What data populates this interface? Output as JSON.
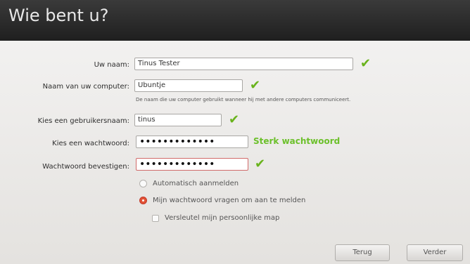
{
  "window": {
    "title": "Wie bent u?"
  },
  "form": {
    "name": {
      "label": "Uw naam:",
      "value": "Tinus Tester"
    },
    "computer": {
      "label": "Naam van uw computer:",
      "value": "Ubuntje",
      "hint": "De naam die uw computer gebruikt wanneer hij met andere computers communiceert."
    },
    "username": {
      "label": "Kies een gebruikersnaam:",
      "value": "tinus"
    },
    "password": {
      "label": "Kies een wachtwoord:",
      "value": "•••••••••••••",
      "strength": "Sterk wachtwoord"
    },
    "confirm": {
      "label": "Wachtwoord bevestigen:",
      "value": "•••••••••••••"
    },
    "options": {
      "auto_login": "Automatisch aanmelden",
      "require_password": "Mijn wachtwoord vragen om aan te melden",
      "encrypt_home": "Versleutel mijn persoonlijke map"
    }
  },
  "buttons": {
    "back": "Terug",
    "forward": "Verder"
  },
  "colors": {
    "accent_green": "#6cc02b",
    "radio_selected": "#e25236"
  },
  "icons": {
    "valid": "check-icon"
  }
}
